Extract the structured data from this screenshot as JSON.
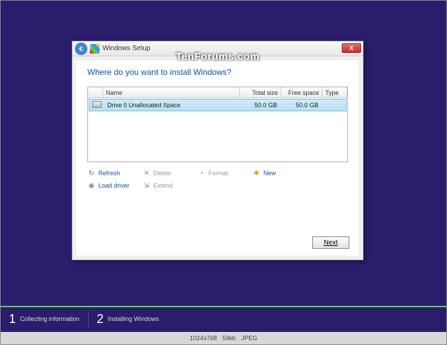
{
  "window": {
    "title": "Windows Setup",
    "watermark": "TenForums.com",
    "heading": "Where do you want to install Windows?",
    "close_label": "X"
  },
  "table": {
    "headers": {
      "name": "Name",
      "total": "Total size",
      "free": "Free space",
      "type": "Type"
    },
    "rows": [
      {
        "name": "Drive 0 Unallocated Space",
        "total": "50.0 GB",
        "free": "50.0 GB",
        "type": ""
      }
    ]
  },
  "actions": {
    "refresh": "Refresh",
    "delete": "Delete",
    "format": "Format",
    "new": "New",
    "load": "Load driver",
    "extend": "Extend"
  },
  "buttons": {
    "next": "Next"
  },
  "steps": {
    "s1_num": "1",
    "s1_label": "Collecting information",
    "s2_num": "2",
    "s2_label": "Installing Windows"
  },
  "meta": {
    "dims": "1024x768",
    "size": "59kb",
    "format": "JPEG"
  }
}
